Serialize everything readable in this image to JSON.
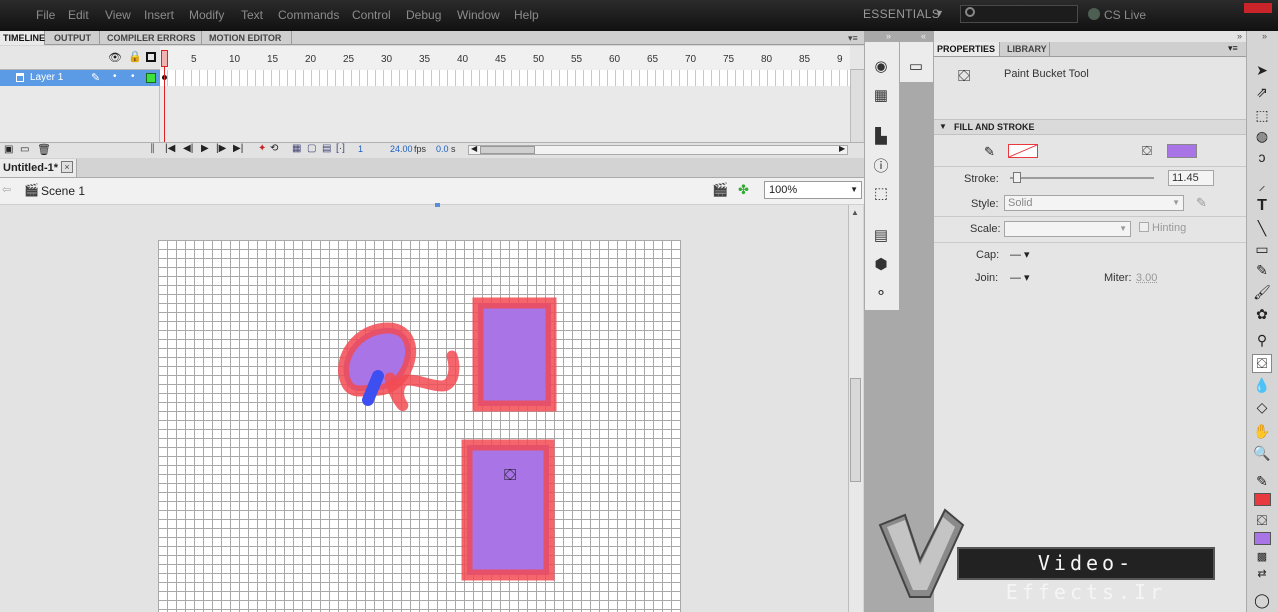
{
  "menubar": {
    "items": [
      "File",
      "Edit",
      "View",
      "Insert",
      "Modify",
      "Text",
      "Commands",
      "Control",
      "Debug",
      "Window",
      "Help"
    ],
    "workspace": "ESSENTIALS",
    "cslive": "CS Live"
  },
  "timeline": {
    "tabs": [
      "TIMELINE",
      "OUTPUT",
      "COMPILER ERRORS",
      "MOTION EDITOR"
    ],
    "ruler": [
      "1",
      "5",
      "10",
      "15",
      "20",
      "25",
      "30",
      "35",
      "40",
      "45",
      "50",
      "55",
      "60",
      "65",
      "70",
      "75",
      "80",
      "85",
      "9"
    ],
    "layer_name": "Layer 1",
    "current_frame": "1",
    "fps": "24.00",
    "fps_unit": "fps",
    "time": "0.0",
    "time_unit": "s"
  },
  "document": {
    "tab": "Untitled-1*",
    "scene": "Scene 1",
    "zoom": "100%"
  },
  "properties": {
    "tabs": [
      "PROPERTIES",
      "LIBRARY"
    ],
    "tool_name": "Paint Bucket Tool",
    "section": "FILL AND STROKE",
    "stroke_label": "Stroke:",
    "stroke_value": "11.45",
    "style_label": "Style:",
    "style_value": "Solid",
    "scale_label": "Scale:",
    "hinting_label": "Hinting",
    "cap_label": "Cap:",
    "join_label": "Join:",
    "miter_label": "Miter:",
    "miter_value": "3.00",
    "stroke_color": "#e8393f",
    "fill_color": "#a874e6"
  },
  "watermark": "Video-Effects.Ir"
}
